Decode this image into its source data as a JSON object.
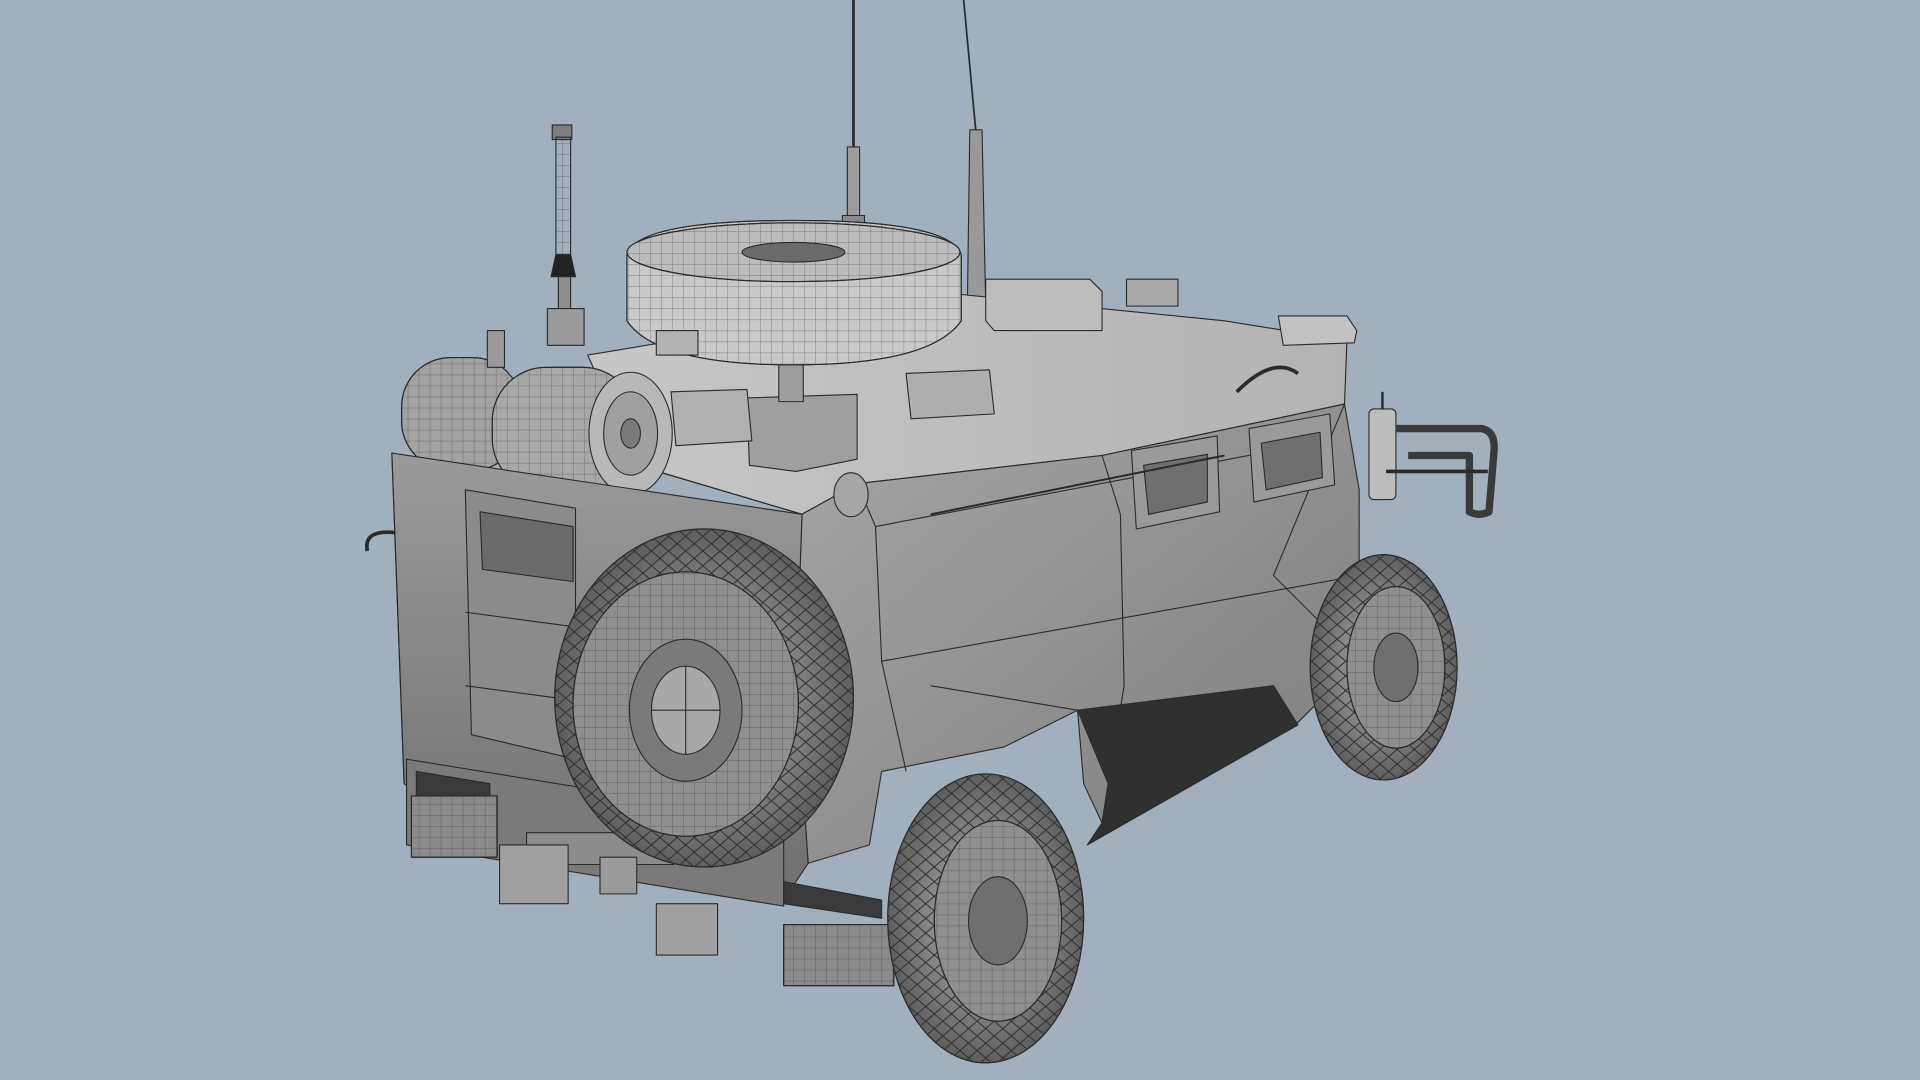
{
  "scene": {
    "subject": "",
    "background_color": "#a2afbd",
    "render_style": "wireframe-shaded",
    "model_base_color": "#8f8f8f",
    "edge_color": "#2a2a2a"
  }
}
